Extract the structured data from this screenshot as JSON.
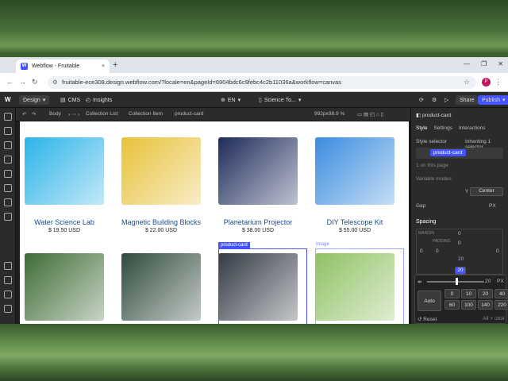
{
  "browser": {
    "tab_title": "Webflow - Fruitable",
    "tab_close": "×",
    "new_tab": "+",
    "win_btns": [
      "—",
      "❐",
      "✕"
    ],
    "url": "fruitable-ece308.design.webflow.com/?locale=en&pageId=6904bdc6c9febc4c2b11036a&workflow=canvas",
    "avatar": "P"
  },
  "topbar": {
    "logo": "W",
    "mode": "Design",
    "cms": "CMS",
    "insights": "Insights",
    "locale": "EN",
    "page": "Science To...",
    "share": "Share",
    "publish": "Publish"
  },
  "breadcrumb": {
    "items": [
      "Body",
      "Collection List",
      "Collection Item",
      "product-card"
    ],
    "size": "992px",
    "zoom": "98.9 %"
  },
  "products": [
    {
      "name": "Water Science Lab",
      "price": "$ 19.50 USD",
      "color": "#2bb3e8"
    },
    {
      "name": "Magnetic Building Blocks",
      "price": "$ 22.00 USD",
      "color": "#e8c13a"
    },
    {
      "name": "Planetarium Projector",
      "price": "$ 38.00 USD",
      "color": "#1d2b5a"
    },
    {
      "name": "DIY Telescope Kit",
      "price": "$ 55.00 USD",
      "color": "#3a8de0"
    },
    {
      "name": "",
      "price": "",
      "color": "#3e6b36"
    },
    {
      "name": "",
      "price": "",
      "color": "#2f4a3c"
    },
    {
      "name": "",
      "price": "",
      "color": "#333a44"
    },
    {
      "name": "",
      "price": "",
      "color": "#8fc163"
    }
  ],
  "selection": {
    "card_badge": "product-card",
    "image_badge": "Image"
  },
  "panel": {
    "element": "product-card",
    "tabs": [
      "Style",
      "Settings",
      "Interactions"
    ],
    "style_selector": "Style selector",
    "inheriting": "Inheriting 1 selector",
    "selector_pill": "product-card",
    "on_this_page": "1 on this page",
    "variable_modes": "Variable modes",
    "align": "Center",
    "y": "Y",
    "gap": "Gap",
    "gap_unit": "PX",
    "spacing": "Spacing",
    "margin": "MARGIN",
    "padding": "PADDING",
    "m_vals": [
      "0",
      "0",
      "0",
      "0"
    ],
    "p_vals": [
      "0",
      "0",
      "20",
      "20"
    ],
    "slider_val": "20",
    "slider_unit": "PX",
    "auto": "Auto",
    "presets": [
      "0",
      "10",
      "20",
      "40",
      "60",
      "100",
      "140",
      "220"
    ],
    "reset": "Reset",
    "alt": "Alt + click"
  }
}
